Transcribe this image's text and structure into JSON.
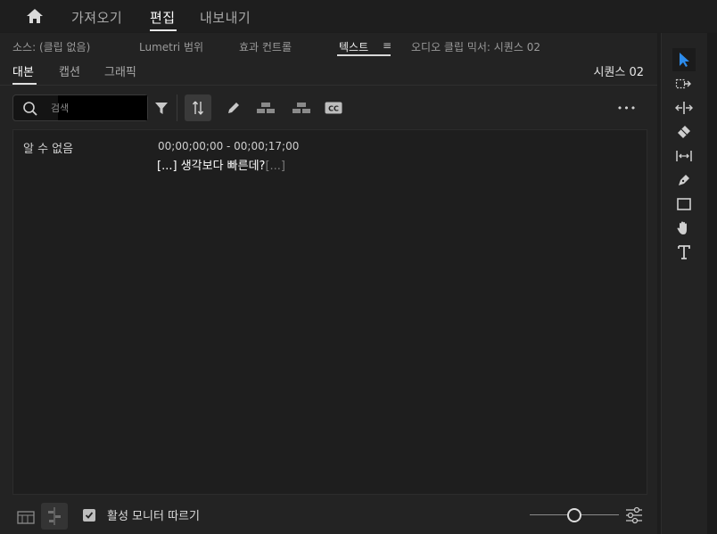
{
  "workspace_tabs": [
    "가져오기",
    "편집",
    "내보내기"
  ],
  "panel_tabs": {
    "source": "소스: (클립 없음)",
    "lumetri": "Lumetri 범위",
    "effect_controls": "효과 컨트롤",
    "text": "텍스트",
    "text_menu_glyph": "≡",
    "audio_mixer": "오디오 클립 믹서: 시퀀스 02"
  },
  "sub_tabs": [
    "대본",
    "캡션",
    "그래픽"
  ],
  "sequence_label": "시퀀스 02",
  "search": {
    "placeholder": "검색"
  },
  "toolbar": {
    "more_glyph": "•••"
  },
  "transcript": {
    "speaker": "알 수 없음",
    "timecode": "00;00;00;00 - 00;00;17;00",
    "leading_ellipsis": "[...]",
    "text": "생각보다 빠른데?",
    "trailing_ellipsis": "[...]"
  },
  "footer": {
    "follow_monitor_label": "활성 모니터 따르기",
    "follow_monitor_checked": true
  },
  "colors": {
    "selection_tool": "#2d8ceb",
    "panel_bg": "#232323"
  },
  "tools": [
    "selection-icon",
    "track-select-icon",
    "ripple-edit-icon",
    "razor-icon",
    "slip-icon",
    "pen-icon",
    "rectangle-icon",
    "hand-icon",
    "type-icon"
  ]
}
